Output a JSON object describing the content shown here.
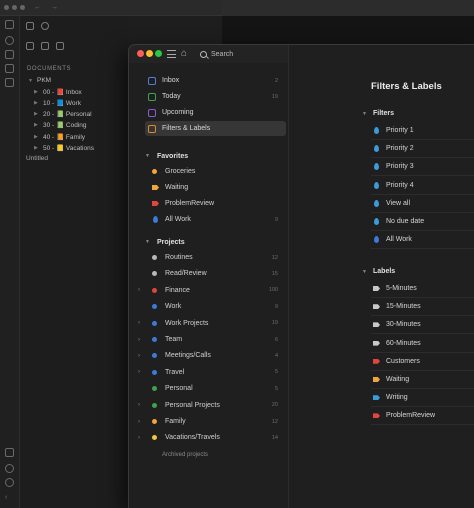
{
  "background_app": {
    "nav_arrows": "← →",
    "documents_header": "DOCUMENTS",
    "tree_root": "PKM",
    "tree_items": [
      {
        "label": "00 - 📕 Inbox",
        "color": "#c9c9c9"
      },
      {
        "label": "10 - 📘 Work",
        "color": "#3b7ad9"
      },
      {
        "label": "20 - 📗 Personal",
        "color": "#4caf50"
      },
      {
        "label": "30 - 📗 Coding",
        "color": "#4caf50"
      },
      {
        "label": "40 - 📙 Family",
        "color": "#e09a2a"
      },
      {
        "label": "50 - 📒 Vacations",
        "color": "#e5c23a"
      }
    ],
    "untitled": "Untitled"
  },
  "window": {
    "search_placeholder": "Search",
    "traffic_lights": [
      "#ff5f57",
      "#febc2e",
      "#28c840"
    ]
  },
  "sidebar": {
    "nav": [
      {
        "label": "Inbox",
        "count": "2",
        "icon": "inbox-icon",
        "color": "#4f7fd6"
      },
      {
        "label": "Today",
        "count": "19",
        "icon": "calendar-today-icon",
        "color": "#3fa34d"
      },
      {
        "label": "Upcoming",
        "count": "",
        "icon": "calendar-upcoming-icon",
        "color": "#8a5bd1"
      },
      {
        "label": "Filters & Labels",
        "count": "",
        "icon": "filters-grid-icon",
        "color": "#e08a2a"
      }
    ],
    "favorites_header": "Favorites",
    "favorites": [
      {
        "label": "Groceries",
        "count": "",
        "kind": "dot",
        "color": "#f2a43a"
      },
      {
        "label": "Waiting",
        "count": "",
        "kind": "tag",
        "color": "#f2a43a"
      },
      {
        "label": "ProblemReview",
        "count": "",
        "kind": "tag",
        "color": "#e0463e"
      },
      {
        "label": "All Work",
        "count": "9",
        "kind": "drop",
        "color": "#3b7ad9"
      }
    ],
    "projects_header": "Projects",
    "projects": [
      {
        "label": "Routines",
        "count": "12",
        "color": "#b8b8b8",
        "expandable": false
      },
      {
        "label": "Read/Review",
        "count": "15",
        "color": "#b8b8b8",
        "expandable": false
      },
      {
        "label": "Finance",
        "count": "100",
        "color": "#e0463e",
        "expandable": true
      },
      {
        "label": "Work",
        "count": "9",
        "color": "#3b7ad9",
        "expandable": false
      },
      {
        "label": "Work Projects",
        "count": "19",
        "color": "#3b7ad9",
        "expandable": true
      },
      {
        "label": "Team",
        "count": "6",
        "color": "#3b7ad9",
        "expandable": true
      },
      {
        "label": "Meetings/Calls",
        "count": "4",
        "color": "#3b7ad9",
        "expandable": true
      },
      {
        "label": "Travel",
        "count": "5",
        "color": "#3b7ad9",
        "expandable": true
      },
      {
        "label": "Personal",
        "count": "5",
        "color": "#3fa34d",
        "expandable": false
      },
      {
        "label": "Personal Projects",
        "count": "20",
        "color": "#3fa34d",
        "expandable": true
      },
      {
        "label": "Family",
        "count": "12",
        "color": "#f2a43a",
        "expandable": true
      },
      {
        "label": "Vacations/Travels",
        "count": "14",
        "color": "#f2c53a",
        "expandable": true
      }
    ],
    "archived": "Archived projects"
  },
  "main": {
    "title": "Filters & Labels",
    "filters_header": "Filters",
    "filters": [
      {
        "label": "Priority 1",
        "color": "#3b9bd9"
      },
      {
        "label": "Priority 2",
        "color": "#3b9bd9"
      },
      {
        "label": "Priority 3",
        "color": "#3b9bd9"
      },
      {
        "label": "Priority 4",
        "color": "#3b9bd9"
      },
      {
        "label": "View all",
        "color": "#3b9bd9"
      },
      {
        "label": "No due date",
        "color": "#3b9bd9"
      },
      {
        "label": "All Work",
        "color": "#3b7ad9"
      }
    ],
    "labels_header": "Labels",
    "labels": [
      {
        "label": "5-Minutes",
        "color": "#c8c8c8"
      },
      {
        "label": "15-Minutes",
        "color": "#c8c8c8"
      },
      {
        "label": "30-Minutes",
        "color": "#c8c8c8"
      },
      {
        "label": "60-Minutes",
        "color": "#c8c8c8"
      },
      {
        "label": "Customers",
        "color": "#e0463e"
      },
      {
        "label": "Waiting",
        "color": "#f2a43a"
      },
      {
        "label": "Writing",
        "color": "#3b9bd9"
      },
      {
        "label": "ProblemReview",
        "color": "#e0463e"
      }
    ]
  }
}
